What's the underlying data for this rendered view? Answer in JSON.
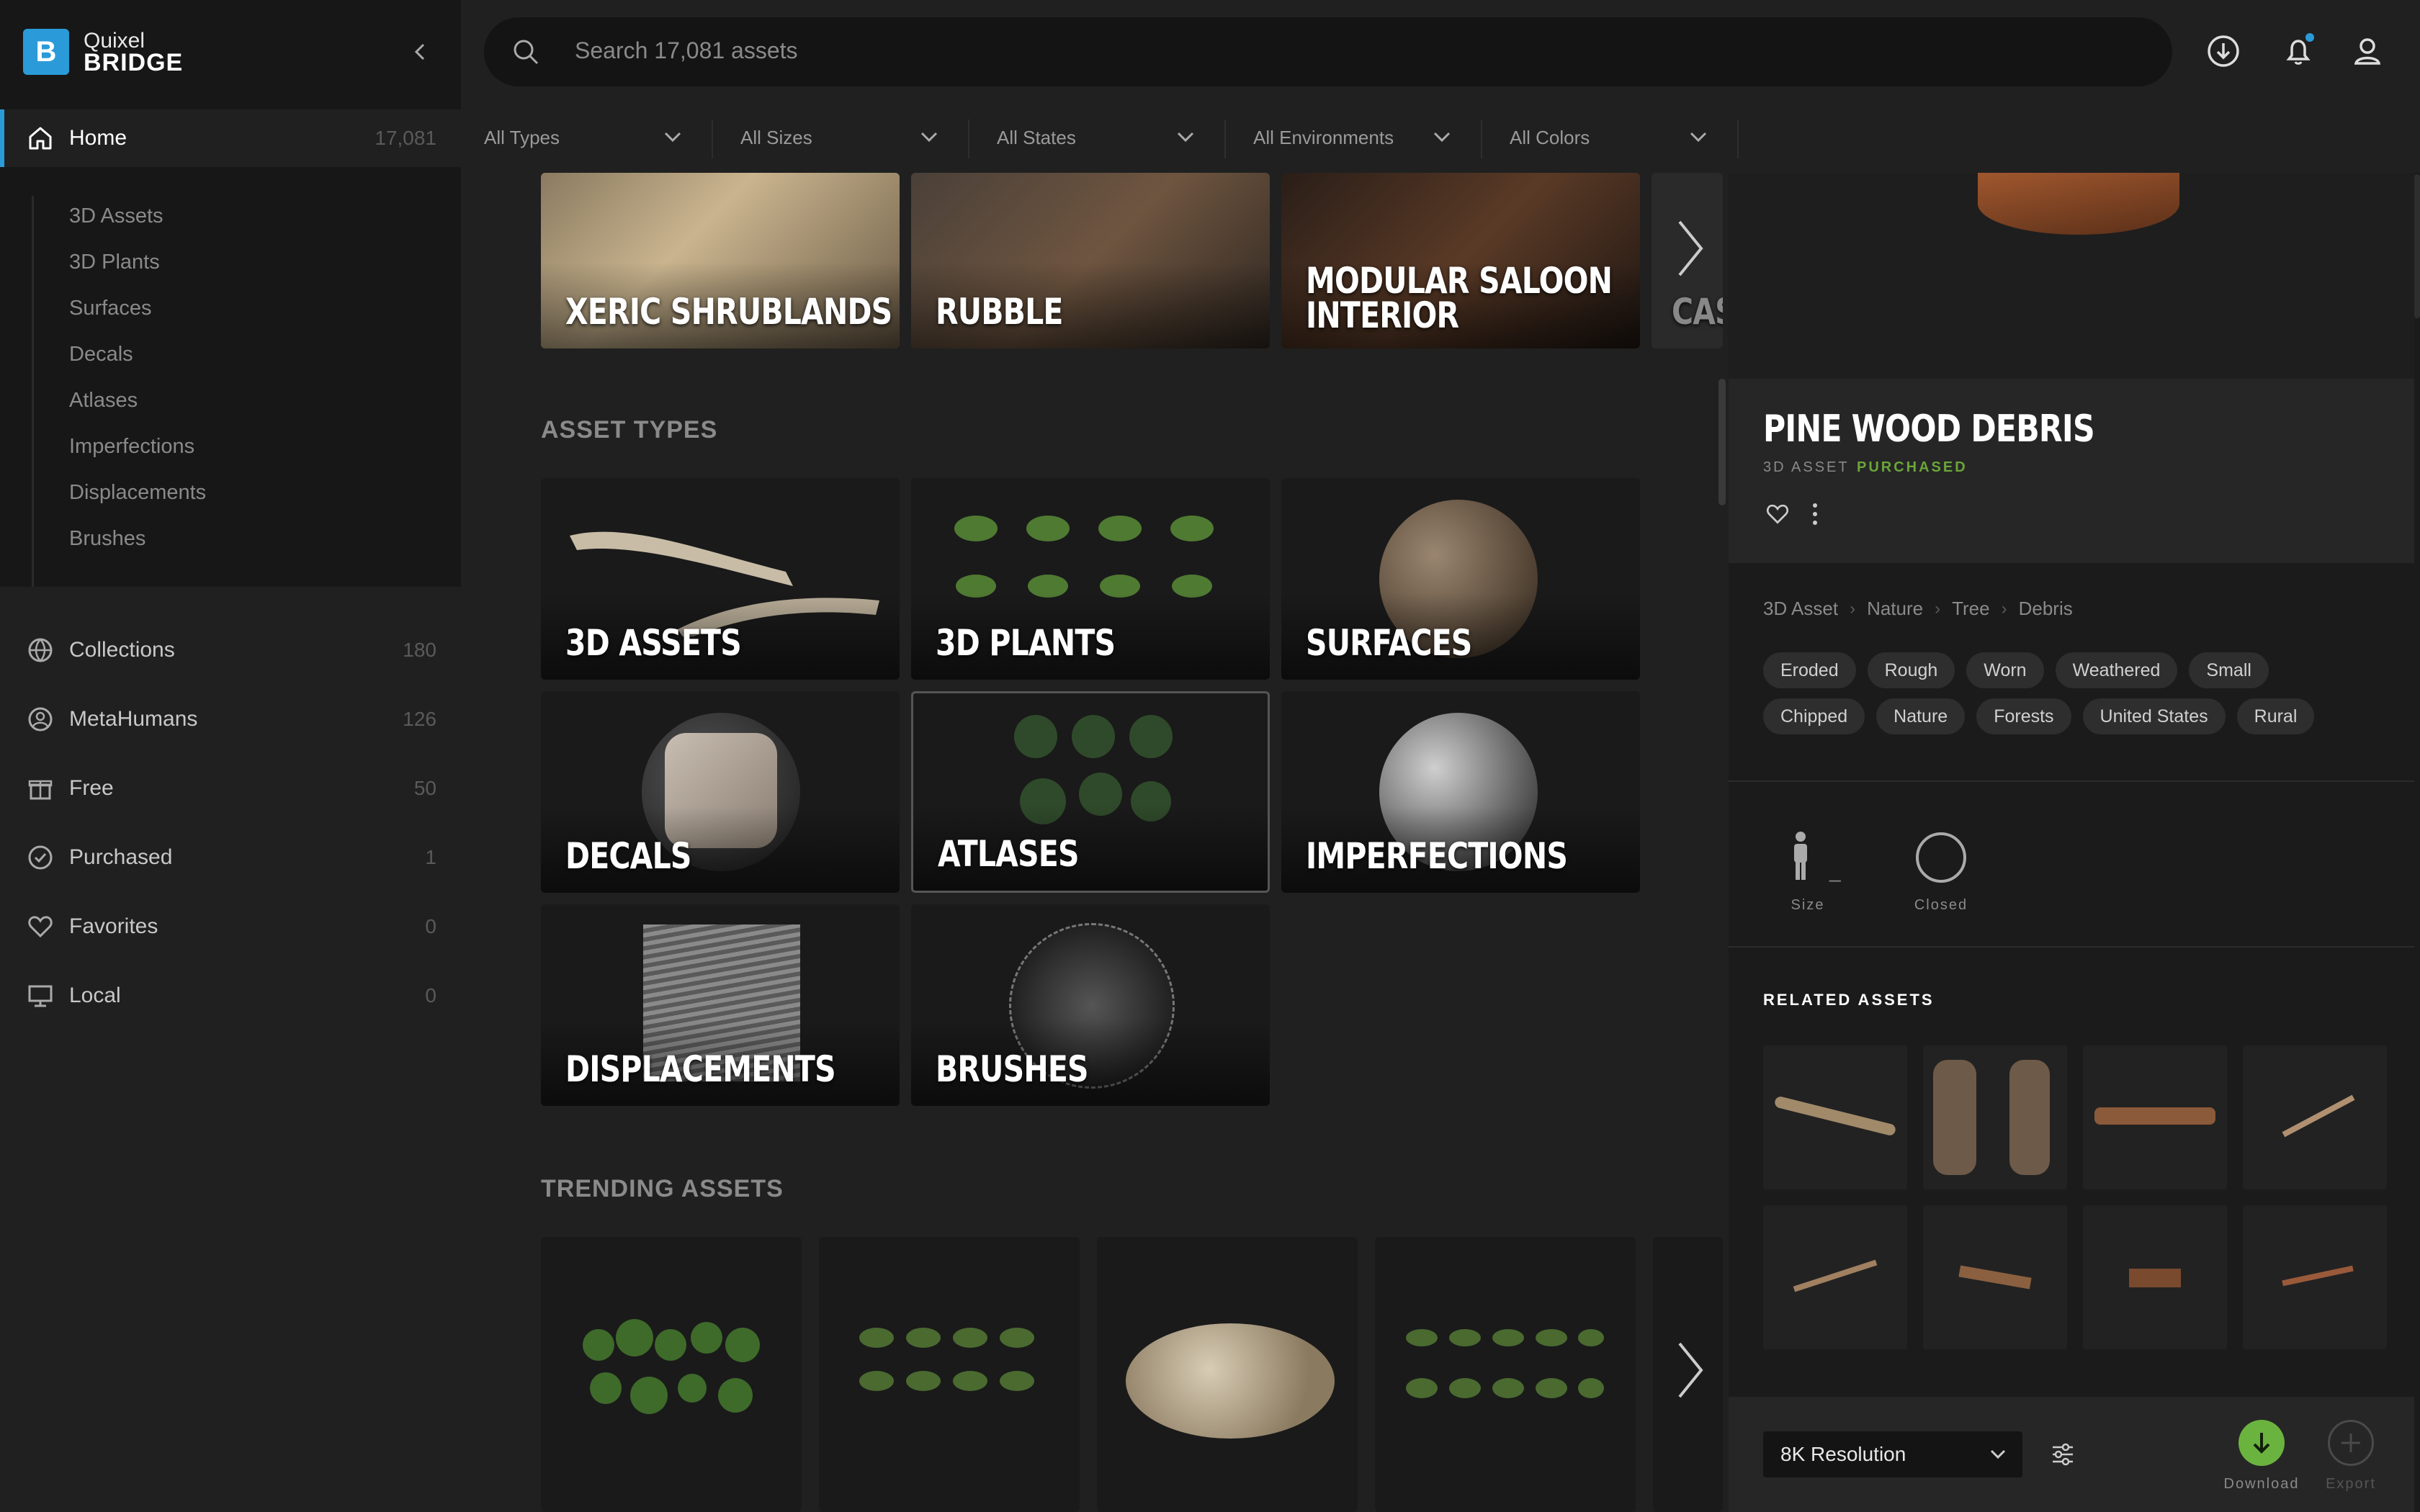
{
  "app": {
    "logo_line1": "Quixel",
    "logo_line2": "BRIDGE",
    "logo_letter": "B"
  },
  "sidebar": {
    "home": {
      "label": "Home",
      "count": "17,081"
    },
    "sub_items": [
      "3D Assets",
      "3D Plants",
      "Surfaces",
      "Decals",
      "Atlases",
      "Imperfections",
      "Displacements",
      "Brushes"
    ],
    "items": [
      {
        "label": "Collections",
        "count": "180",
        "icon": "globe-icon"
      },
      {
        "label": "MetaHumans",
        "count": "126",
        "icon": "user-circle-icon"
      },
      {
        "label": "Free",
        "count": "50",
        "icon": "gift-icon"
      },
      {
        "label": "Purchased",
        "count": "1",
        "icon": "check-circle-icon"
      },
      {
        "label": "Favorites",
        "count": "0",
        "icon": "heart-icon"
      },
      {
        "label": "Local",
        "count": "0",
        "icon": "monitor-icon"
      }
    ]
  },
  "search": {
    "placeholder": "Search 17,081 assets"
  },
  "filters": [
    "All Types",
    "All Sizes",
    "All States",
    "All Environments",
    "All Colors"
  ],
  "collections_row": [
    "XERIC SHRUBLANDS",
    "RUBBLE",
    "MODULAR SALOON\nINTERIOR",
    "CAS"
  ],
  "asset_types": {
    "title": "ASSET TYPES",
    "cards": [
      "3D ASSETS",
      "3D PLANTS",
      "SURFACES",
      "DECALS",
      "ATLASES",
      "IMPERFECTIONS",
      "DISPLACEMENTS",
      "BRUSHES"
    ]
  },
  "trending": {
    "title": "TRENDING ASSETS"
  },
  "panel": {
    "name": "PINE WOOD DEBRIS",
    "type": "3D ASSET",
    "status": "PURCHASED",
    "breadcrumb": [
      "3D Asset",
      "Nature",
      "Tree",
      "Debris"
    ],
    "tags_row1": [
      "Eroded",
      "Rough",
      "Worn",
      "Weathered",
      "Small"
    ],
    "tags_row2": [
      "Chipped",
      "Nature",
      "Forests",
      "United States",
      "Rural"
    ],
    "stats": [
      {
        "label": "Size",
        "value": "_"
      },
      {
        "label": "Closed"
      }
    ],
    "related_title": "RELATED ASSETS",
    "resolution": "8K Resolution",
    "download_label": "Download",
    "export_label": "Export"
  },
  "colors": {
    "accent": "#2a9bd8",
    "download": "#6bb33f",
    "purchased": "#6aa53a"
  }
}
